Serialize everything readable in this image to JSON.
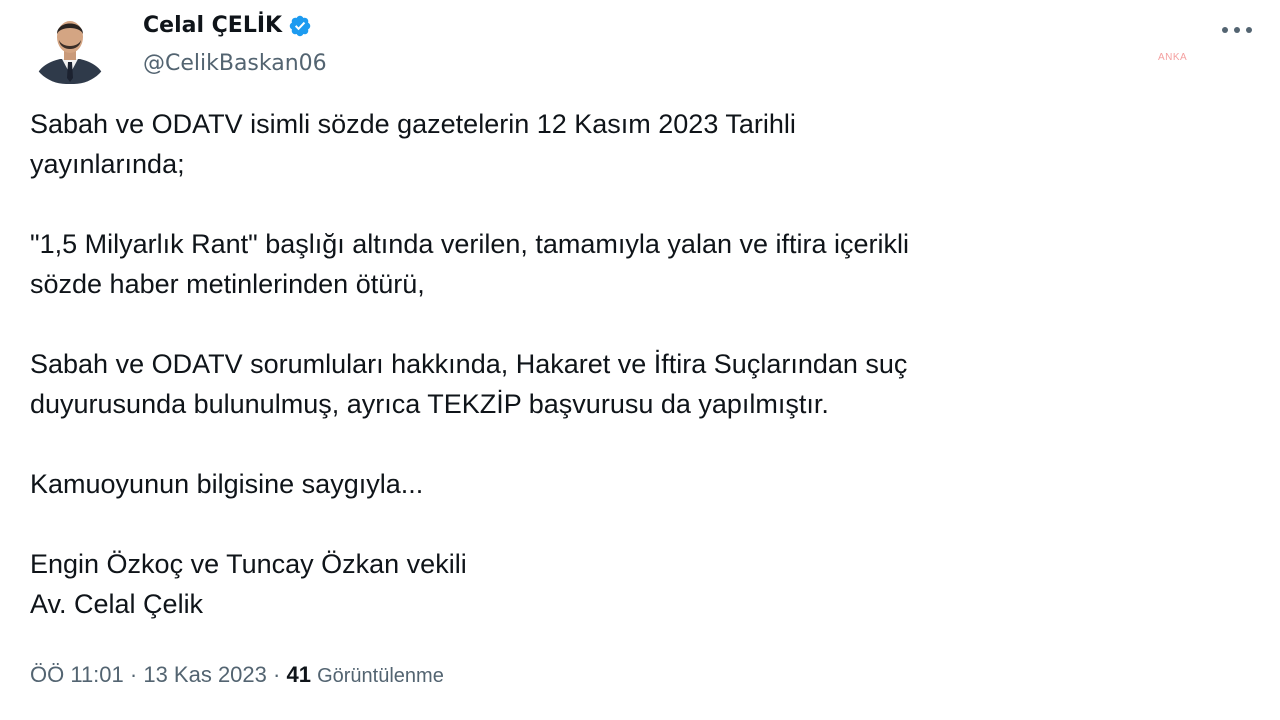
{
  "author": {
    "name": "Celal ÇELİK",
    "handle": "@CelikBaskan06",
    "verified": true,
    "verified_color": "#1d9bf0"
  },
  "watermark": "ANKA",
  "tweet": {
    "paragraphs": [
      "Sabah ve ODATV isimli sözde gazetelerin 12 Kasım 2023 Tarihli\nyayınlarında;",
      "\"1,5 Milyarlık Rant\" başlığı altında verilen, tamamıyla yalan ve iftira içerikli\nsözde haber metinlerinden ötürü,",
      "Sabah ve ODATV sorumluları hakkında, Hakaret ve İftira Suçlarından suç\nduyurusunda bulunulmuş, ayrıca TEKZİP başvurusu da yapılmıştır.",
      "Kamuoyunun bilgisine saygıyla...",
      "Engin Özkoç ve Tuncay Özkan vekili\nAv. Celal Çelik"
    ]
  },
  "meta": {
    "time": "ÖÖ 11:01",
    "separator": "·",
    "date": "13 Kas 2023",
    "views_count": "41",
    "views_label": "Görüntülenme"
  },
  "icons": {
    "more": "more-options-icon",
    "verified": "verified-badge-icon",
    "avatar": "profile-avatar"
  }
}
